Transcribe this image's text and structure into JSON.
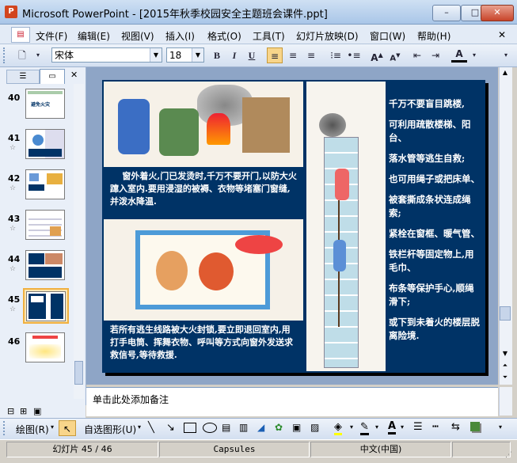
{
  "window": {
    "app_icon": "P",
    "title": "Microsoft PowerPoint - [2015年秋季校园安全主题班会课件.ppt]",
    "min_symbol": "–",
    "max_symbol": "□",
    "close_symbol": "✕"
  },
  "menu": {
    "items": [
      "文件(F)",
      "编辑(E)",
      "视图(V)",
      "插入(I)",
      "格式(O)",
      "工具(T)",
      "幻灯片放映(D)",
      "窗口(W)",
      "帮助(H)"
    ],
    "close_doc": "✕"
  },
  "toolbar": {
    "font_name": "宋体",
    "font_size": "18",
    "bold": "B",
    "italic": "I",
    "underline": "U",
    "font_color_label": "A"
  },
  "slides_panel": {
    "close": "✕",
    "slides": [
      {
        "number": "40",
        "thumb_text": "避免火灾"
      },
      {
        "number": "41",
        "thumb_text": ""
      },
      {
        "number": "42",
        "thumb_text": ""
      },
      {
        "number": "43",
        "thumb_text": ""
      },
      {
        "number": "44",
        "thumb_text": ""
      },
      {
        "number": "45",
        "thumb_text": ""
      },
      {
        "number": "46",
        "thumb_text": ""
      }
    ],
    "selected": 45
  },
  "slide": {
    "caption_top": "窗外着火,门已发烫时,千万不要开门,以防大火蹿入室内.要用浸湿的被褥、衣物等堵塞门窗缝,并泼水降温.",
    "caption_bottom": "若所有逃生线路被大火封锁,要立即退回室内,用打手电筒、挥舞衣物、呼叫等方式向窗外发送求救信号,等待救援.",
    "right_text": [
      "千万不要盲目跳楼,",
      "可利用疏散楼梯、阳台、",
      "落水管等逃生自救;",
      "也可用绳子或把床单、",
      "被套撕成条状连成绳索;",
      "紧栓在窗框、暖气管、",
      "铁栏杆等固定物上,用毛巾、",
      "布条等保护手心,顺绳滑下;",
      "或下到未着火的楼层脱离险境."
    ]
  },
  "notes": {
    "placeholder": "单击此处添加备注"
  },
  "drawbar": {
    "draw_label": "绘图(R)",
    "autoshape_label": "自选图形(U)"
  },
  "status": {
    "slide_info": "幻灯片 45 / 46",
    "design": "Capsules",
    "language": "中文(中国)"
  },
  "colors": {
    "slide_bg": "#003366",
    "slide_text": "#ffffff",
    "accent": "#f8d58a"
  }
}
